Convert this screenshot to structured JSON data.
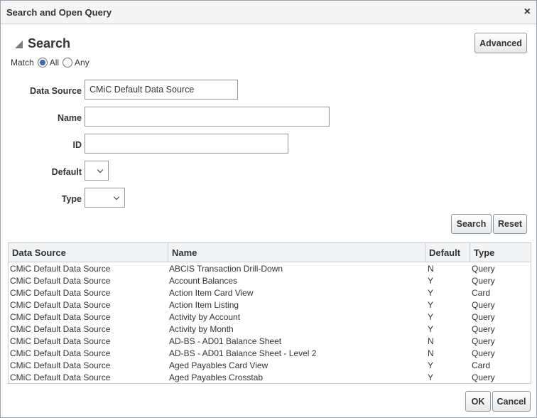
{
  "dialog": {
    "title": "Search and Open Query",
    "close_icon": "×"
  },
  "search": {
    "section_title": "Search",
    "advanced_label": "Advanced",
    "match_label": "Match",
    "match_all": "All",
    "match_any": "Any",
    "match_selected": "All",
    "data_source_label": "Data Source",
    "data_source_value": "CMiC Default Data Source",
    "name_label": "Name",
    "name_value": "",
    "id_label": "ID",
    "id_value": "",
    "default_label": "Default",
    "default_value": "",
    "type_label": "Type",
    "type_value": "",
    "search_button": "Search",
    "reset_button": "Reset"
  },
  "table": {
    "columns": [
      "Data Source",
      "Name",
      "Default",
      "Type"
    ],
    "rows": [
      [
        "CMiC Default Data Source",
        "ABCIS Transaction Drill-Down",
        "N",
        "Query"
      ],
      [
        "CMiC Default Data Source",
        "Account Balances",
        "Y",
        "Query"
      ],
      [
        "CMiC Default Data Source",
        "Action Item Card View",
        "Y",
        "Card"
      ],
      [
        "CMiC Default Data Source",
        "Action Item Listing",
        "Y",
        "Query"
      ],
      [
        "CMiC Default Data Source",
        "Activity by Account",
        "Y",
        "Query"
      ],
      [
        "CMiC Default Data Source",
        "Activity by Month",
        "Y",
        "Query"
      ],
      [
        "CMiC Default Data Source",
        "AD-BS - AD01 Balance Sheet",
        "N",
        "Query"
      ],
      [
        "CMiC Default Data Source",
        "AD-BS - AD01 Balance Sheet - Level 2",
        "N",
        "Query"
      ],
      [
        "CMiC Default Data Source",
        "Aged Payables Card View",
        "Y",
        "Card"
      ],
      [
        "CMiC Default Data Source",
        "Aged Payables Crosstab",
        "Y",
        "Query"
      ]
    ]
  },
  "footer": {
    "ok_button": "OK",
    "cancel_button": "Cancel"
  }
}
